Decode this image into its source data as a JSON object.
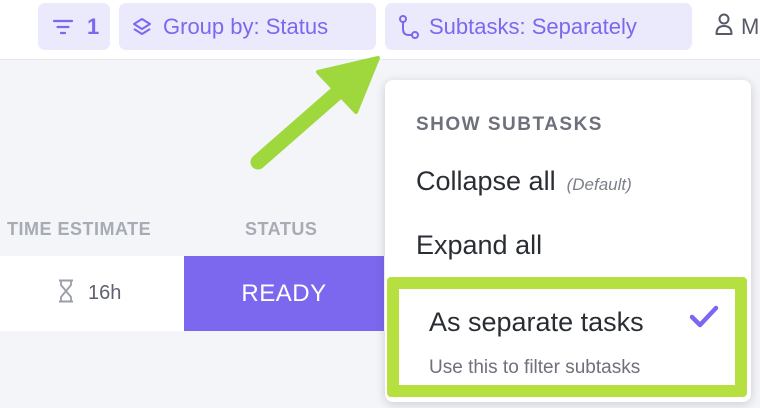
{
  "toolbar": {
    "filter_count": "1",
    "group_by_label": "Group by: Status",
    "subtasks_label": "Subtasks: Separately",
    "me_label": "M"
  },
  "table": {
    "headers": {
      "time_estimate": "TIME ESTIMATE",
      "status": "STATUS"
    },
    "row": {
      "time_estimate": "16h",
      "status": "READY"
    }
  },
  "dropdown": {
    "title": "SHOW SUBTASKS",
    "collapse_label": "Collapse all",
    "collapse_note": "(Default)",
    "expand_label": "Expand all",
    "separate_label": "As separate tasks",
    "separate_desc": "Use this to filter subtasks",
    "selected": "As separate tasks"
  },
  "icons": {
    "filter": "filter-icon",
    "group": "layers-icon",
    "subtasks": "subtasks-icon",
    "me": "user-icon",
    "time": "hourglass-icon",
    "check": "checkmark-icon",
    "annotation": "arrow-annotation-icon"
  },
  "colors": {
    "accent": "#7b68ee",
    "chip_bg": "#ebe9fc",
    "status_ready": "#7b68ee",
    "highlight": "#b6e040",
    "arrow": "#9ed83c"
  }
}
